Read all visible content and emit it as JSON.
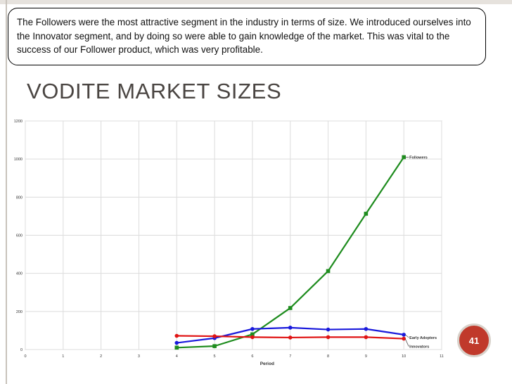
{
  "callout": {
    "text": "The Followers were the most attractive segment in the industry in terms of size.  We introduced ourselves into the Innovator segment, and by doing so were able to gain knowledge of the market. This was vital to the success of our Follower product, which was very profitable."
  },
  "slide": {
    "title": "VODITE MARKET SIZES",
    "page_number": "41"
  },
  "colors": {
    "followers": "#1e8c1e",
    "early_adopters": "#1a1adc",
    "innovators": "#e01414",
    "badge": "#c0392b",
    "grid": "#dcdcdc"
  },
  "chart_data": {
    "type": "line",
    "title": "",
    "xlabel": "Period",
    "ylabel": "",
    "xlim": [
      0,
      11
    ],
    "ylim": [
      0,
      1200
    ],
    "x_ticks": [
      0,
      1,
      2,
      3,
      4,
      5,
      6,
      7,
      8,
      9,
      10,
      11
    ],
    "y_ticks": [
      0,
      200,
      400,
      600,
      800,
      1000,
      1200
    ],
    "grid": true,
    "legend": "inline labels at line ends",
    "series": [
      {
        "name": "Followers",
        "color": "#1e8c1e",
        "marker": "square",
        "x": [
          4,
          5,
          6,
          7,
          8,
          9,
          10
        ],
        "y": [
          10,
          18,
          80,
          218,
          412,
          713,
          1010
        ]
      },
      {
        "name": "Early Adopters",
        "color": "#1a1adc",
        "marker": "circle",
        "x": [
          4,
          5,
          6,
          7,
          8,
          9,
          10
        ],
        "y": [
          35,
          60,
          108,
          115,
          105,
          108,
          78
        ]
      },
      {
        "name": "Innovators",
        "color": "#e01414",
        "marker": "circle",
        "x": [
          4,
          5,
          6,
          7,
          8,
          9,
          10
        ],
        "y": [
          72,
          70,
          65,
          63,
          65,
          65,
          57
        ]
      }
    ]
  }
}
